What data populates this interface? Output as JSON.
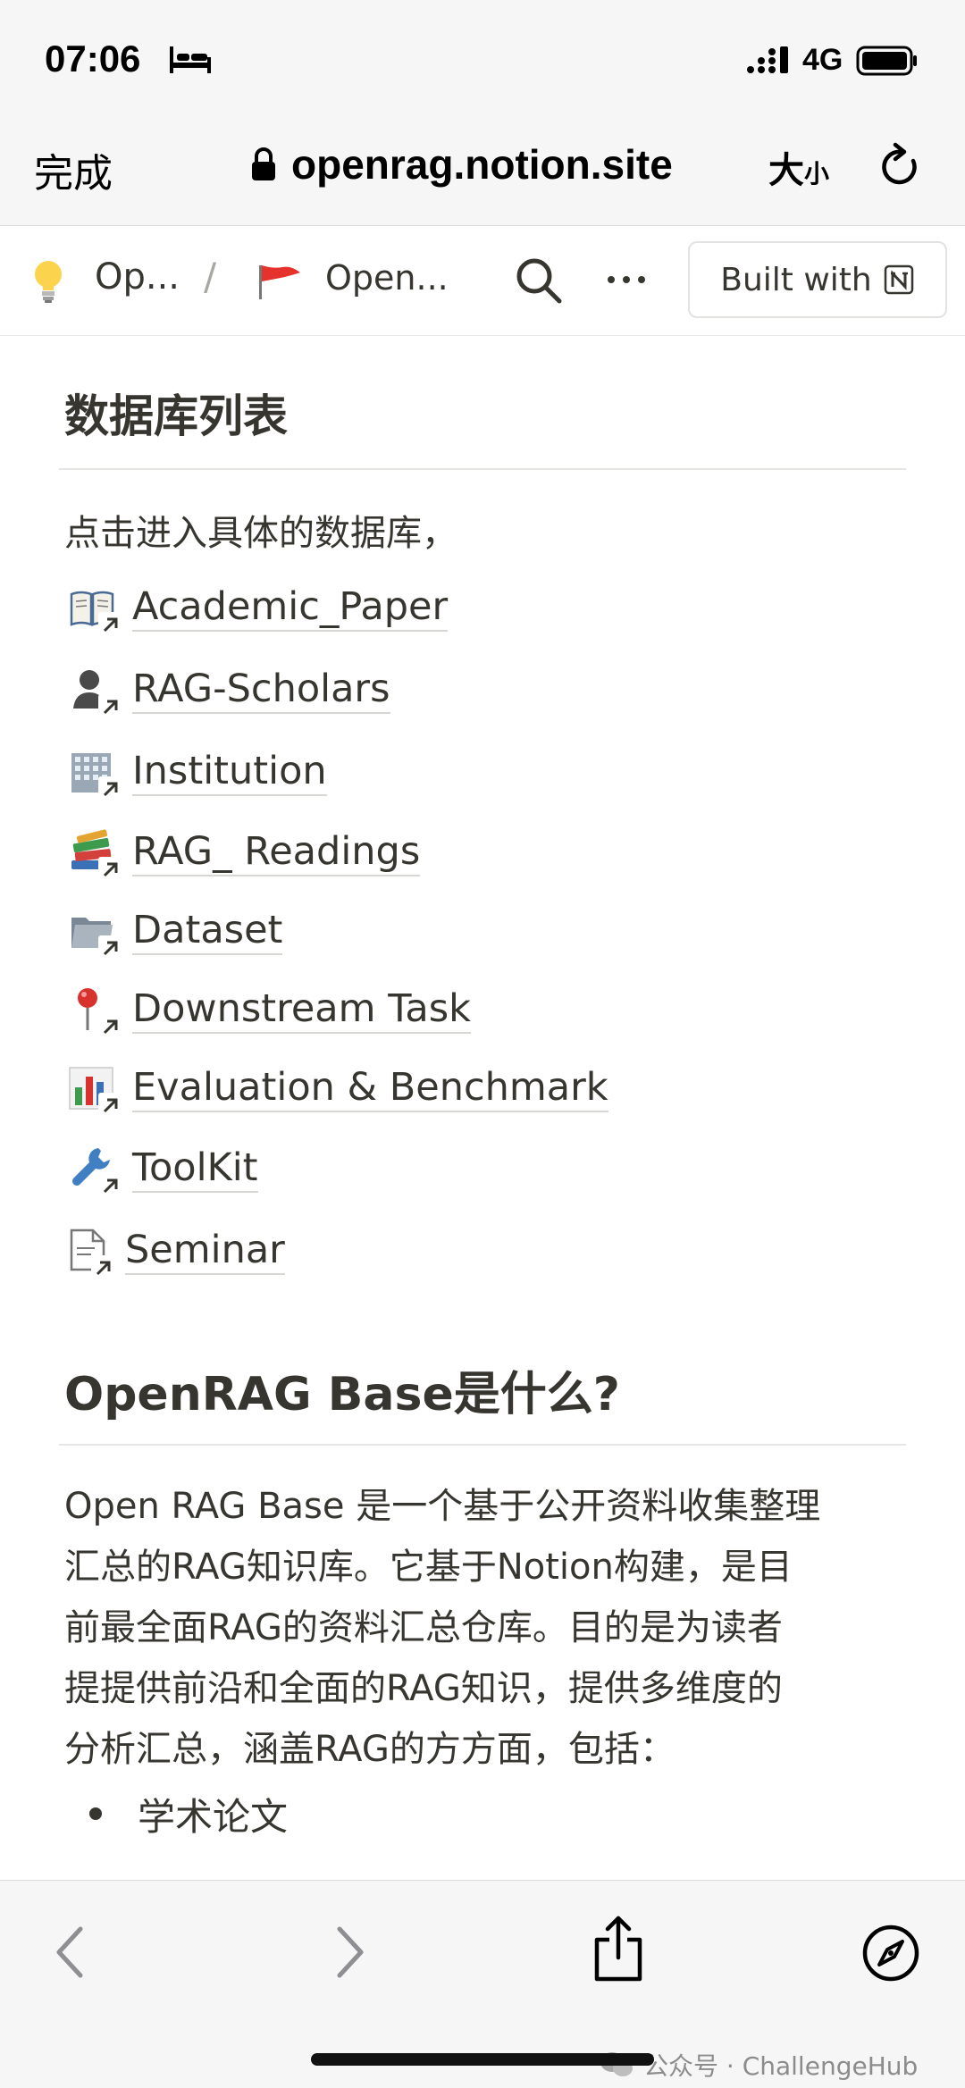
{
  "status_bar": {
    "time": "07:06",
    "network": "4G"
  },
  "browser": {
    "done_label": "完成",
    "url": "openrag.notion.site",
    "text_size_large": "大",
    "text_size_small": "小"
  },
  "notion_header": {
    "breadcrumb_1": "Op...",
    "separator": "/",
    "breadcrumb_2": "Open...",
    "built_with_label": "Built with"
  },
  "content": {
    "heading_1": "数据库列表",
    "intro": "点击进入具体的数据库，",
    "databases": [
      {
        "label": "Academic_Paper",
        "icon": "open-book-icon"
      },
      {
        "label": "RAG-Scholars",
        "icon": "person-silhouette-icon"
      },
      {
        "label": "Institution",
        "icon": "office-building-icon"
      },
      {
        "label": "RAG_ Readings",
        "icon": "books-stack-icon"
      },
      {
        "label": "Dataset",
        "icon": "folder-icon"
      },
      {
        "label": "Downstream Task",
        "icon": "round-pushpin-icon"
      },
      {
        "label": "Evaluation & Benchmark",
        "icon": "bar-chart-icon"
      },
      {
        "label": "ToolKit",
        "icon": "wrench-icon"
      },
      {
        "label": "Seminar",
        "icon": "document-icon"
      }
    ],
    "heading_2": "OpenRAG Base是什么?",
    "paragraph_lines": [
      "Open RAG Base 是一个基于公开资料收集整理",
      "汇总的RAG知识库。它基于Notion构建，是目",
      "前最全面RAG的资料汇总仓库。目的是为读者",
      "提提供前沿和全面的RAG知识，提供多维度的",
      "分析汇总，涵盖RAG的方方面，包括："
    ],
    "bullet_1": "学术论文"
  },
  "watermark": "公众号 · ChallengeHub"
}
